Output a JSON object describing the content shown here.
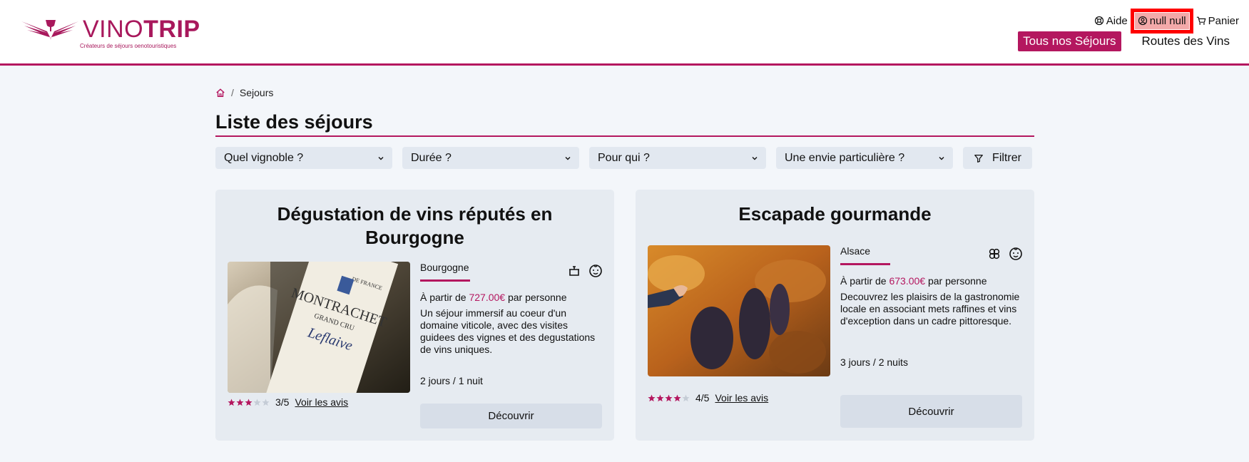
{
  "brand": {
    "name_light": "VINO",
    "name_bold": "TRIP",
    "tagline": "Créateurs de séjours oenotouristiques",
    "color": "#a8185c"
  },
  "top_links": {
    "help": "Aide",
    "user": "null null",
    "cart": "Panier"
  },
  "nav": {
    "items": [
      {
        "label": "Tous nos Séjours",
        "active": true
      },
      {
        "label": "Routes des Vins",
        "active": false
      }
    ]
  },
  "breadcrumb": {
    "current": "Sejours"
  },
  "page_title": "Liste des séjours",
  "filters": {
    "vineyard": "Quel vignoble ?",
    "duration": "Durée ?",
    "audience": "Pour qui ?",
    "wish": "Une envie particulière ?",
    "button": "Filtrer"
  },
  "cards": [
    {
      "title": "Dégustation de vins réputés en Bourgogne",
      "region": "Bourgogne",
      "price_prefix": "À partir de",
      "price": "727.00€",
      "price_suffix": "par personne",
      "description": "Un séjour immersif au coeur d'un domaine viticole, avec des visites guidees des vignes et des degustations de vins uniques.",
      "duration": "2 jours / 1 nuit",
      "rating": 3,
      "rating_text": "3/5",
      "reviews_link": "Voir les avis",
      "cta": "Découvrir",
      "image_label_1": "MONTRACHET",
      "image_label_2": "GRAND CRU",
      "image_label_3": "DE FRANCE",
      "image_label_4": "Leflaive",
      "icons": [
        "cooking-pot-icon",
        "child-face-icon"
      ]
    },
    {
      "title": "Escapade gourmande",
      "region": "Alsace",
      "price_prefix": "À partir de",
      "price": "673.00€",
      "price_suffix": "par personne",
      "description": "Decouvrez les plaisirs de la gastronomie locale en associant mets raffines et vins d'exception dans un cadre pittoresque.",
      "duration": "3 jours / 2 nuits",
      "rating": 4,
      "rating_text": "4/5",
      "reviews_link": "Voir les avis",
      "cta": "Découvrir",
      "icons": [
        "flower-icon",
        "child-face-icon"
      ]
    }
  ],
  "colors": {
    "accent": "#b4175f",
    "card_bg": "#e6ebf1",
    "page_bg": "#f3f6fa",
    "highlight": "#ff0000"
  }
}
